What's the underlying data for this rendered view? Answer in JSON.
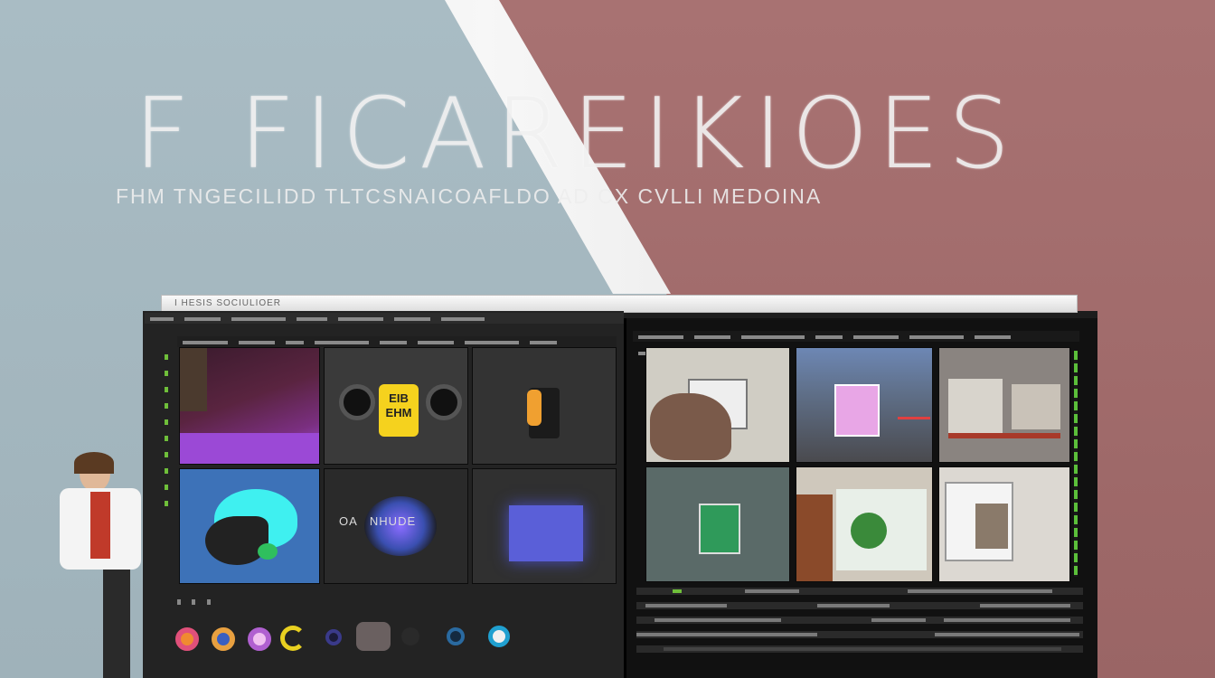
{
  "hero": {
    "title": "F FICAREIKIOES",
    "subtitle": "FHM TNGECILIDD TLTCSNAICOAFLDO AD CX CVLLI MEDOINA"
  },
  "window": {
    "title": "I    HESIS    SOCIULIOER"
  },
  "thumbnails_left": [
    {
      "name": "purple-room-thumb"
    },
    {
      "name": "speaker-thumb",
      "label": "EIB\nEHM"
    },
    {
      "name": "orange-object-thumb"
    },
    {
      "name": "cyan-shape-thumb"
    },
    {
      "name": "glowing-logo-thumb",
      "label": "OA   NHUDE"
    },
    {
      "name": "blue-square-thumb"
    }
  ],
  "thumbnails_right": [
    {
      "name": "gallery-wall-thumb"
    },
    {
      "name": "pink-poster-thumb"
    },
    {
      "name": "interior-room-thumb"
    },
    {
      "name": "green-frame-thumb"
    },
    {
      "name": "plant-window-thumb"
    },
    {
      "name": "shelf-room-thumb"
    }
  ],
  "colors": {
    "bg_left": "#a9bcc4",
    "bg_right": "#a87272",
    "panel": "#232323",
    "accent_green": "#5bbf3a"
  },
  "icons": [
    "pink-ring-icon",
    "orange-ring-icon",
    "purple-ring-icon",
    "yellow-ring-icon",
    "navy-ring-icon",
    "gray-square-icon",
    "dark-ring-icon",
    "teal-ring-icon",
    "blue-ring-icon"
  ]
}
